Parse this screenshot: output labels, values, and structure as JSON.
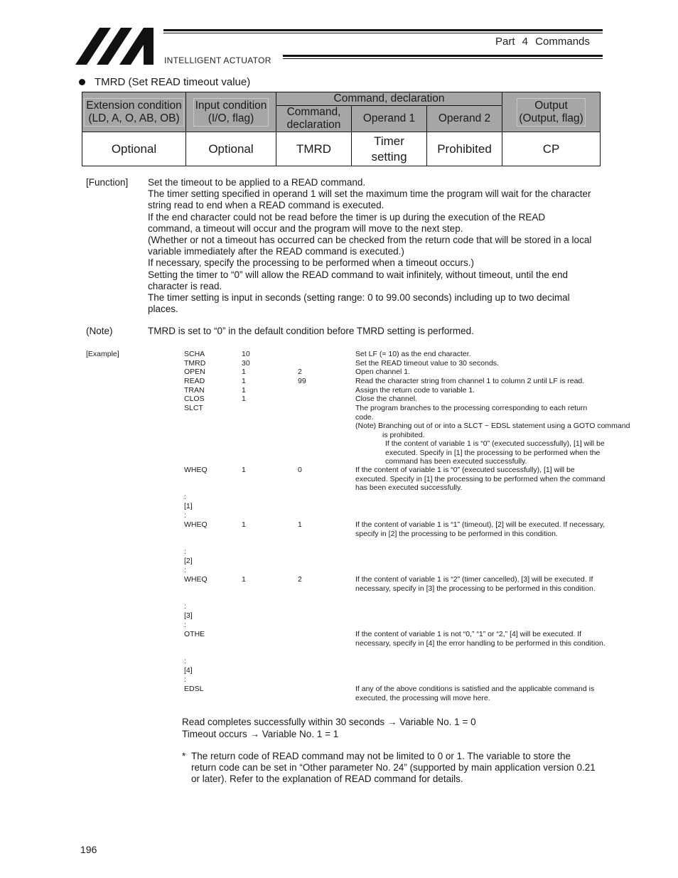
{
  "header": {
    "brand": "INTELLIGENT ACTUATOR",
    "logo_icon": "iai-logo-icon",
    "part_title": "Part 4   Commands"
  },
  "section": {
    "bullet_icon": "bullet-icon",
    "title": "TMRD (Set READ timeout value)"
  },
  "spec_table": {
    "headers": {
      "extension_condition": [
        "Extension condition",
        "(LD, A, O, AB, OB)"
      ],
      "input_condition": [
        "Input condition",
        "(I/O, flag)"
      ],
      "command_group": "Command, declaration",
      "command": [
        "Command,",
        "declaration"
      ],
      "operand1": "Operand 1",
      "operand2": "Operand 2",
      "output": [
        "Output",
        "(Output, flag)"
      ]
    },
    "row": {
      "extension_condition": "Optional",
      "input_condition": "Optional",
      "command": "TMRD",
      "operand1": [
        "Timer",
        "setting"
      ],
      "operand2": "Prohibited",
      "output": "CP"
    }
  },
  "function": {
    "label": "[Function]",
    "lines": [
      "Set the timeout to be applied to a READ command.",
      "The timer setting specified in operand 1 will set the maximum time the program will wait for the character string read to end when a READ command is executed.",
      "If the end character could not be read before the timer is up during the execution of the READ command, a timeout will occur and the program will move to the next step.",
      "(Whether or not a timeout has occurred can be checked from the return code that will be stored in a local variable immediately after the READ command is executed.)",
      "If necessary, specify the processing to be performed when a timeout occurs.)",
      "Setting the timer to “0” will allow the READ command to wait infinitely, without timeout, until the end character is read.",
      "The timer setting is input in seconds (setting range: 0 to 99.00 seconds) including up to two decimal places."
    ]
  },
  "note": {
    "label": "(Note)",
    "text": "TMRD is set to “0” in the default condition before TMRD setting is performed."
  },
  "example": {
    "label": "[Example]",
    "rows": [
      {
        "cmd": "SCHA",
        "op1": "10",
        "op2": "",
        "desc": "Set LF (= 10) as the end character."
      },
      {
        "cmd": "TMRD",
        "op1": "30",
        "op2": "",
        "desc": "Set the READ timeout value to 30 seconds."
      },
      {
        "cmd": "OPEN",
        "op1": "1",
        "op2": "2",
        "desc": "Open channel 1."
      },
      {
        "cmd": "READ",
        "op1": "1",
        "op2": "99",
        "desc": "Read the character string from channel 1 to column 2 until LF is read."
      },
      {
        "cmd": "TRAN",
        "op1": "1",
        "op2": "",
        "desc": "Assign the return code to variable 1."
      },
      {
        "cmd": "CLOS",
        "op1": "1",
        "op2": "",
        "desc": "Close the channel."
      },
      {
        "cmd": "SLCT",
        "op1": "",
        "op2": "",
        "desc": "The program branches to the processing corresponding to each return code."
      }
    ],
    "slct_note": "(Note)  Branching out of or into a SLCT ~ EDSL statement using a GOTO command is prohibited.",
    "slct_sub": "If the content of variable 1 is “0” (executed successfully), [1] will be executed. Specify in [1] the processing to be performed when the command has been executed successfully.",
    "wheq0": {
      "cmd": "WHEQ",
      "op1": "1",
      "op2": "0",
      "desc": "If the content of variable 1 is “0” (executed successfully), [1] will be executed. Specify in [1] the processing to be performed when the command has been executed successfully."
    },
    "block1": {
      "colon_a": ":",
      "label": "[1]",
      "colon_b": ":"
    },
    "wheq1": {
      "cmd": "WHEQ",
      "op1": "1",
      "op2": "1",
      "desc": "If the content of variable 1 is “1” (timeout), [2] will be executed. If necessary, specify in [2] the processing to be performed in this condition."
    },
    "block2": {
      "colon_a": ":",
      "label": "[2]",
      "colon_b": ":"
    },
    "wheq2": {
      "cmd": "WHEQ",
      "op1": "1",
      "op2": "2",
      "desc": "If the content of variable 1 is “2” (timer cancelled), [3] will be executed. If necessary, specify in [3] the processing to be performed in this condition."
    },
    "block3": {
      "colon_a": ":",
      "label": "[3]",
      "colon_b": ":"
    },
    "othe": {
      "cmd": "OTHE",
      "desc": "If the content of variable 1 is not “0,” “1” or “2,” [4] will be executed. If necessary, specify in [4] the error handling to be performed in this condition."
    },
    "block4": {
      "colon_a": ":",
      "label": "[4]",
      "colon_b": ":"
    },
    "edsl": {
      "cmd": "EDSL",
      "desc": "If any of the above conditions is satisfied and the applicable command is executed, the processing will move here."
    }
  },
  "results": {
    "line1": "Read completes successfully within 30 seconds → Variable No. 1 = 0",
    "line2": "Timeout occurs → Variable No. 1 = 1"
  },
  "footnote": {
    "marker": "*",
    "text": "The return code of READ command may not be limited to 0 or 1. The variable to store the return code can be set in “Other parameter No. 24” (supported by main application version 0.21 or later). Refer to the explanation of READ command for details."
  },
  "page_number": "196"
}
